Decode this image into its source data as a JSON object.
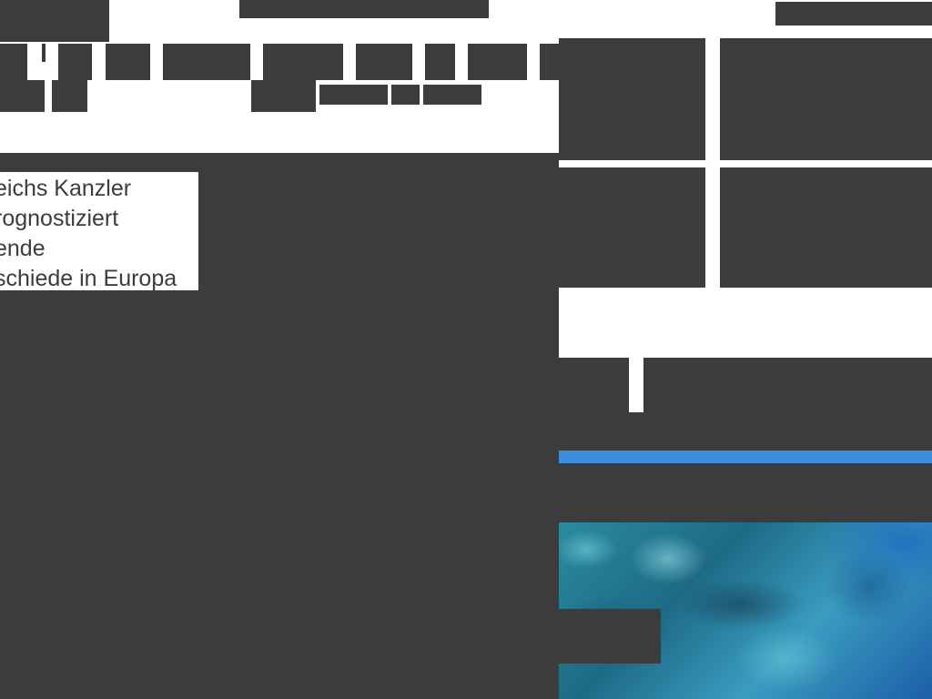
{
  "article": {
    "headline_lines": [
      "eichs Kanzler",
      "rognostiziert",
      "ende",
      "schiede in Europa"
    ]
  },
  "colors": {
    "background": "#3c3c3c",
    "accent_bar": "#3a8ee0",
    "panel": "#ffffff"
  }
}
